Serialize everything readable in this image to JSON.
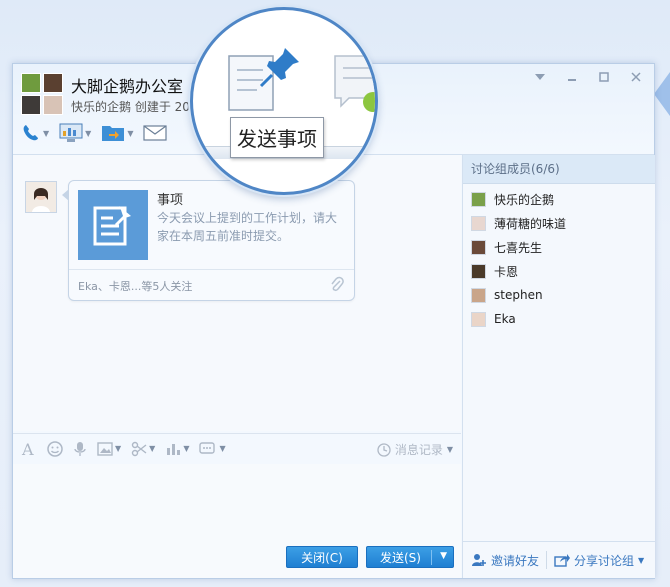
{
  "group": {
    "title": "大脚企鹅办公室",
    "subtitle": "快乐的企鹅 创建于 201"
  },
  "magnifier": {
    "label": "发送事项"
  },
  "message": {
    "card_title": "事项",
    "card_desc": "今天会议上提到的工作计划，请大家在本周五前准时提交。",
    "card_footer": "Eka、卡恩...等5人关注"
  },
  "compose": {
    "history_label": "消息记录",
    "close_label": "关闭(C)",
    "send_label": "发送(S)"
  },
  "members": {
    "header": "讨论组成员(6/6)",
    "list": [
      {
        "name": "快乐的企鹅",
        "color": "#7aa04a"
      },
      {
        "name": "薄荷糖的味道",
        "color": "#e8d7d0"
      },
      {
        "name": "七喜先生",
        "color": "#6a4a3a"
      },
      {
        "name": "卡恩",
        "color": "#4a3a2a"
      },
      {
        "name": "stephen",
        "color": "#c9a58a"
      },
      {
        "name": "Eka",
        "color": "#ead5c8"
      }
    ],
    "invite_label": "邀请好友",
    "share_label": "分享讨论组"
  },
  "colors": {
    "accent": "#1f7fd2",
    "magnifier_border": "#4f86c6",
    "card_icon_bg": "#5b9bd8"
  }
}
